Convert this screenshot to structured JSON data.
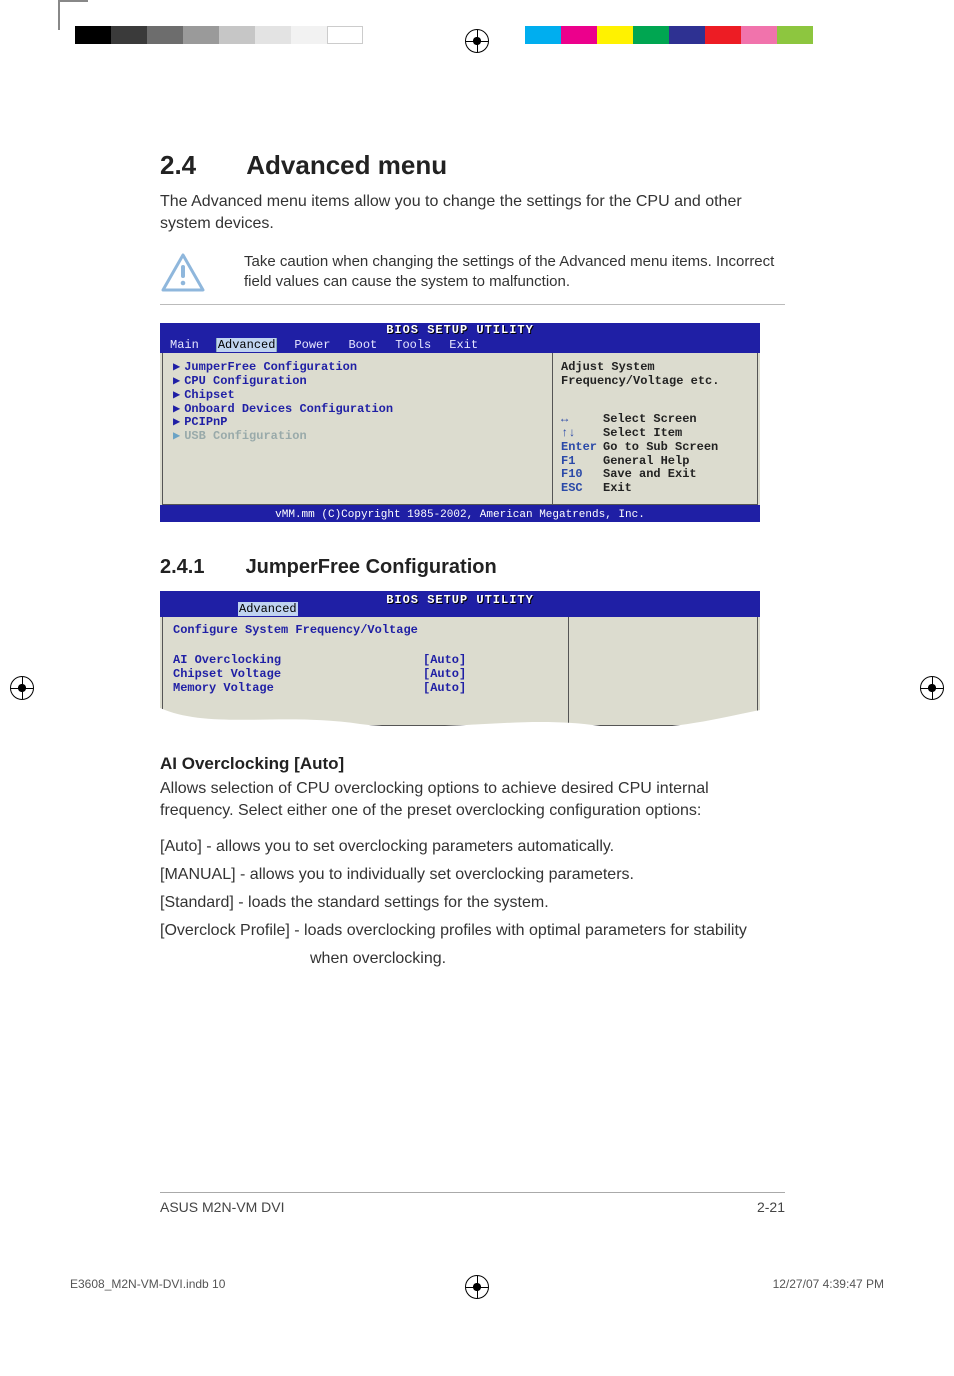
{
  "section": {
    "number": "2.4",
    "title": "Advanced menu"
  },
  "intro": "The Advanced menu items allow you to change the settings for the CPU and other system devices.",
  "caution": "Take caution when changing the settings of the Advanced menu items. Incorrect field values can cause the system to malfunction.",
  "bios1": {
    "title": "BIOS SETUP UTILITY",
    "tabs": [
      "Main",
      "Advanced",
      "Power",
      "Boot",
      "Tools",
      "Exit"
    ],
    "active_tab": "Advanced",
    "items": [
      "JumperFree Configuration",
      "CPU Configuration",
      "Chipset",
      "Onboard Devices Configuration",
      "PCIPnP",
      "USB Configuration"
    ],
    "help": "Adjust System Frequency/Voltage etc.",
    "keys": [
      {
        "key": "↔",
        "desc": "Select Screen"
      },
      {
        "key": "↑↓",
        "desc": "Select Item"
      },
      {
        "key": "Enter",
        "desc": "Go to Sub Screen"
      },
      {
        "key": "F1",
        "desc": "General Help"
      },
      {
        "key": "F10",
        "desc": "Save and Exit"
      },
      {
        "key": "ESC",
        "desc": "Exit"
      }
    ],
    "footer": "vMM.mm (C)Copyright 1985-2002, American Megatrends, Inc."
  },
  "subsection": {
    "number": "2.4.1",
    "title": "JumperFree Configuration"
  },
  "bios2": {
    "title": "BIOS SETUP UTILITY",
    "active_tab": "Advanced",
    "header": "Configure System Frequency/Voltage",
    "settings": [
      {
        "label": "AI Overclocking",
        "value": "[Auto]"
      },
      {
        "label": "Chipset Voltage",
        "value": "[Auto]"
      },
      {
        "label": "Memory Voltage",
        "value": "[Auto]"
      }
    ]
  },
  "option": {
    "title": "AI Overclocking [Auto]",
    "desc": "Allows selection of CPU overclocking options to achieve desired CPU internal frequency. Select either one of the preset overclocking configuration options:",
    "rows": [
      "[Auto] - allows you to set overclocking parameters automatically.",
      "[MANUAL] - allows you to individually set overclocking parameters.",
      "[Standard] - loads the standard settings for the system.",
      "[Overclock Profile] - loads overclocking profiles with optimal parameters for stability"
    ],
    "cont": "when overclocking."
  },
  "footer": {
    "left": "ASUS M2N-VM DVI",
    "right": "2-21"
  },
  "imposition": {
    "file": "E3608_M2N-VM-DVI.indb   10",
    "stamp": "12/27/07   4:39:47 PM"
  }
}
